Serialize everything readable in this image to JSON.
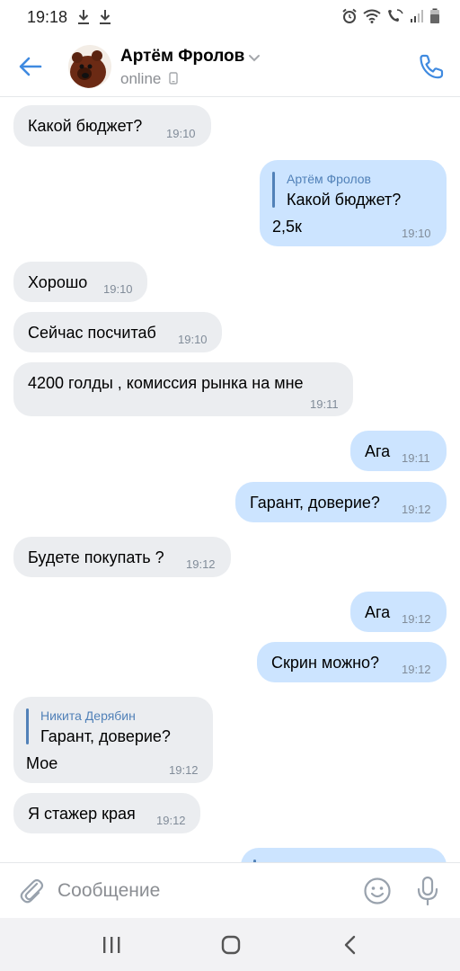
{
  "status_bar": {
    "time": "19:18"
  },
  "header": {
    "contact_name": "Артём Фролов",
    "status": "online"
  },
  "messages": [
    {
      "dir": "in",
      "text": "Какой бюджет?",
      "time": "19:10"
    },
    {
      "dir": "out",
      "reply_name": "Артём Фролов",
      "reply_text": "Какой бюджет?",
      "text": "2,5к",
      "time": "19:10"
    },
    {
      "dir": "in",
      "text": "Хорошо",
      "time": "19:10"
    },
    {
      "dir": "in",
      "text": "Сейчас посчитаб",
      "time": "19:10"
    },
    {
      "dir": "in",
      "text": "4200 голды , комиссия рынка на мне",
      "time": "19:11"
    },
    {
      "dir": "out",
      "text": "Ага",
      "time": "19:11"
    },
    {
      "dir": "out",
      "text": "Гарант, доверие?",
      "time": "19:12"
    },
    {
      "dir": "in",
      "text": "Будете покупать ?",
      "time": "19:12"
    },
    {
      "dir": "out",
      "text": "Ага",
      "time": "19:12"
    },
    {
      "dir": "out",
      "text": "Скрин можно?",
      "time": "19:12"
    },
    {
      "dir": "in",
      "reply_name": "Никита Дерябин",
      "reply_text": "Гарант, доверие?",
      "text": "Мое",
      "time": "19:12"
    },
    {
      "dir": "in",
      "text": "Я стажер края",
      "time": "19:12"
    }
  ],
  "composer": {
    "placeholder": "Сообщение"
  },
  "icons": {
    "back": "arrow-left-icon",
    "phone": "phone-icon",
    "attach": "paperclip-icon",
    "emoji": "smile-icon",
    "mic": "microphone-icon"
  },
  "colors": {
    "accent": "#3f8ae0",
    "incoming_bubble": "#ebedf0",
    "outgoing_bubble": "#cce4ff",
    "reply_name": "#5181b8"
  }
}
